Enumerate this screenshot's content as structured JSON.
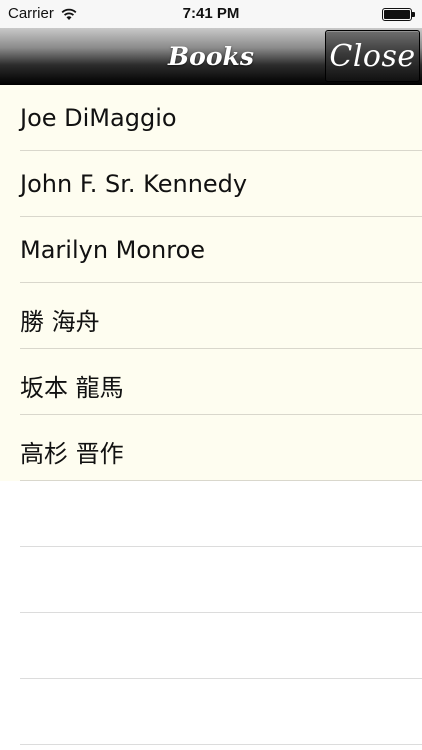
{
  "status_bar": {
    "carrier": "Carrier",
    "time": "7:41 PM",
    "wifi_icon": "wifi-icon",
    "battery_icon": "battery-icon"
  },
  "nav_bar": {
    "title": "Books",
    "close_label": "Close"
  },
  "list": {
    "items": [
      {
        "label": "Joe DiMaggio"
      },
      {
        "label": "John F. Sr. Kennedy"
      },
      {
        "label": "Marilyn Monroe"
      },
      {
        "label": "勝 海舟"
      },
      {
        "label": "坂本 龍馬"
      },
      {
        "label": "高杉 晋作"
      }
    ]
  },
  "colors": {
    "list_background": "#fefdf0",
    "nav_gradient_top": "#c9c9c9",
    "nav_gradient_bottom": "#000000",
    "text": "#111111"
  }
}
